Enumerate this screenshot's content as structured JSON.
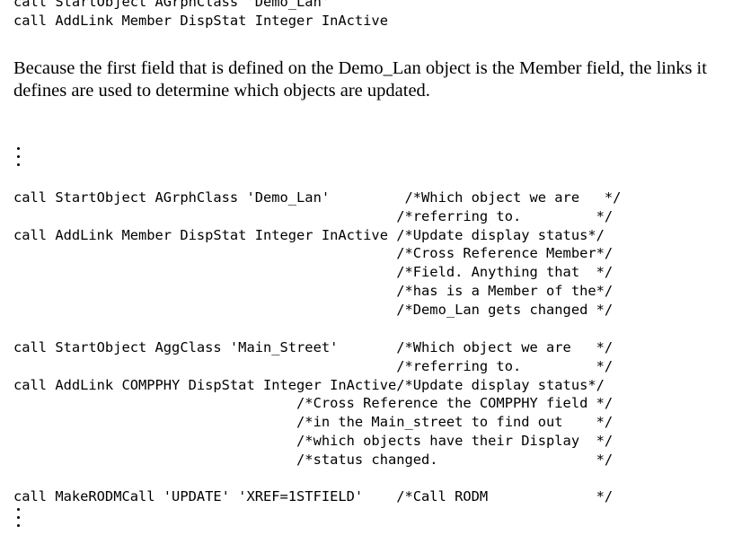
{
  "code_top": [
    "call StartObject AGrphClass 'Demo_Lan'",
    "call AddLink Member DispStat Integer InActive"
  ],
  "prose": "Because the first field that is defined on the Demo_Lan object is the Member field, the links it defines are used to determine which objects are updated.",
  "ellipsis_symbol": "⋮",
  "code_block_1": [
    "call StartObject AGrphClass 'Demo_Lan'         /*Which object we are   */",
    "                                              /*referring to.         */",
    "call AddLink Member DispStat Integer InActive /*Update display status*/",
    "                                              /*Cross Reference Member*/",
    "                                              /*Field. Anything that  */",
    "                                              /*has is a Member of the*/",
    "                                              /*Demo_Lan gets changed */"
  ],
  "code_block_2": [
    "call StartObject AggClass 'Main_Street'       /*Which object we are   */",
    "                                              /*referring to.         */",
    "call AddLink COMPPHY DispStat Integer InActive/*Update display status*/",
    "                                  /*Cross Reference the COMPPHY field */",
    "                                  /*in the Main_street to find out    */",
    "                                  /*which objects have their Display  */",
    "                                  /*status changed.                   */"
  ],
  "code_block_3": [
    "call MakeRODMCall 'UPDATE' 'XREF=1STFIELD'    /*Call RODM             */"
  ]
}
